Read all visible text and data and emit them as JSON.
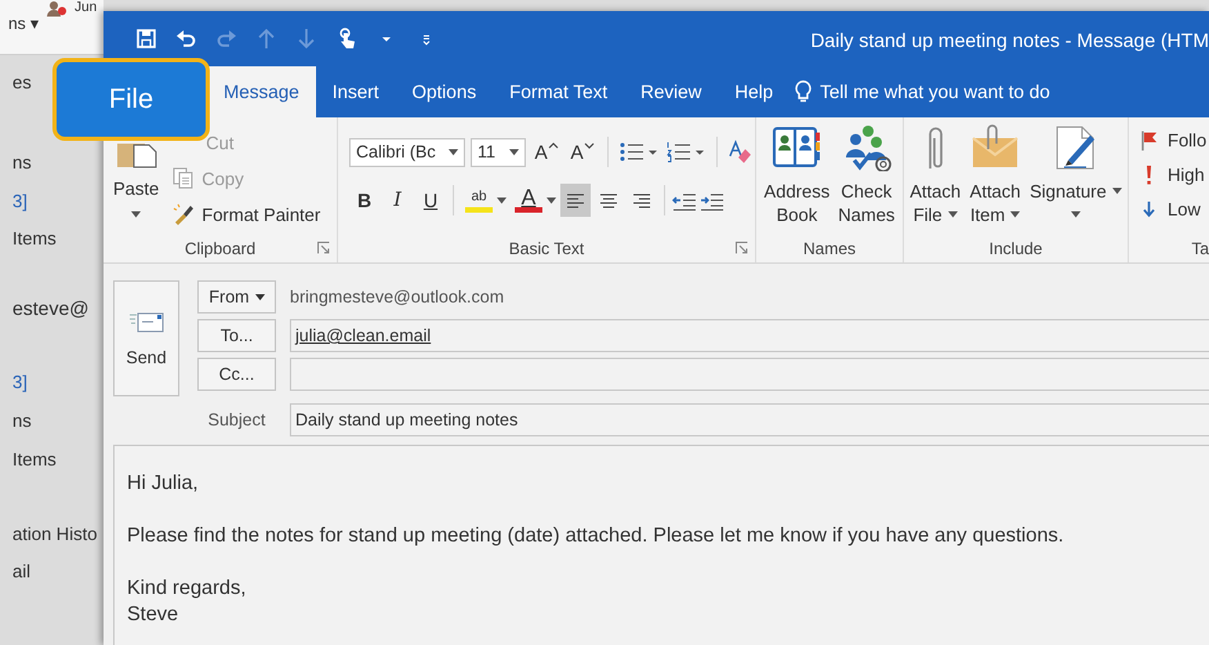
{
  "main_window": {
    "toolbar_texts": [
      "ns ▾",
      "Jun"
    ],
    "folder_items": [
      {
        "label": "es",
        "kind": "folder"
      },
      {
        "label": "ns",
        "kind": "folder"
      },
      {
        "label": "3]",
        "kind": "count"
      },
      {
        "label": "Items",
        "kind": "folder"
      },
      {
        "label": "esteve@",
        "kind": "account"
      },
      {
        "label": "3]",
        "kind": "count"
      },
      {
        "label": "ns",
        "kind": "folder"
      },
      {
        "label": "Items",
        "kind": "folder"
      },
      {
        "label": "ation Histo",
        "kind": "folder"
      },
      {
        "label": "ail",
        "kind": "folder"
      }
    ]
  },
  "message_window": {
    "title": "Daily stand up meeting notes  -  Message (HTM",
    "quick_access": [
      {
        "kind": "save",
        "disabled": false
      },
      {
        "kind": "undo",
        "disabled": false
      },
      {
        "kind": "redo",
        "disabled": true
      },
      {
        "kind": "up",
        "disabled": true
      },
      {
        "kind": "down",
        "disabled": true
      },
      {
        "kind": "touch",
        "disabled": false
      },
      {
        "kind": "dropdown",
        "disabled": false
      },
      {
        "kind": "customize",
        "disabled": false
      }
    ],
    "file_button": {
      "label": "File"
    },
    "tabs": [
      {
        "label": "Message",
        "selected": true
      },
      {
        "label": "Insert",
        "selected": false
      },
      {
        "label": "Options",
        "selected": false
      },
      {
        "label": "Format Text",
        "selected": false
      },
      {
        "label": "Review",
        "selected": false
      },
      {
        "label": "Help",
        "selected": false
      }
    ],
    "tell_me": {
      "label": "Tell me what you want to do"
    },
    "ribbon": {
      "clipboard": {
        "label": "Clipboard",
        "paste": {
          "label": "Paste"
        },
        "commands": [
          {
            "kind": "cut",
            "label": "Cut",
            "disabled": true
          },
          {
            "kind": "copy",
            "label": "Copy",
            "disabled": true
          },
          {
            "kind": "painter",
            "label": "Format Painter",
            "disabled": false
          }
        ]
      },
      "basic_text": {
        "label": "Basic Text",
        "font": "Calibri (Bc",
        "size": "11",
        "grow": "A",
        "shrink": "A",
        "bold": "B",
        "italic": "I",
        "underline": "U",
        "highlight": "ab",
        "font_color": "A",
        "alignments": [
          {
            "kind": "left",
            "selected": true
          },
          {
            "kind": "center",
            "selected": false
          },
          {
            "kind": "right",
            "selected": false
          }
        ]
      },
      "names": {
        "label": "Names",
        "buttons": [
          {
            "kind": "address-book",
            "lines": [
              "Address",
              "Book"
            ],
            "menu": false
          },
          {
            "kind": "check-names",
            "lines": [
              "Check",
              "Names"
            ],
            "menu": false
          }
        ]
      },
      "include": {
        "label": "Include",
        "buttons": [
          {
            "kind": "attach-file",
            "lines": [
              "Attach",
              "File"
            ],
            "menu": true
          },
          {
            "kind": "attach-item",
            "lines": [
              "Attach",
              "Item"
            ],
            "menu": true
          },
          {
            "kind": "signature",
            "lines": [
              "Signature"
            ],
            "menu": true
          }
        ]
      },
      "tags": {
        "label": "Ta",
        "items": [
          {
            "kind": "follow-up",
            "label": "Follo"
          },
          {
            "kind": "high",
            "label": "High"
          },
          {
            "kind": "low",
            "label": "Low"
          }
        ]
      }
    },
    "compose": {
      "send": "Send",
      "from": {
        "label": "From",
        "value": "bringmesteve@outlook.com"
      },
      "to": {
        "label": "To...",
        "value": "julia@clean.email"
      },
      "cc": {
        "label": "Cc..."
      },
      "subject": {
        "label": "Subject",
        "value": "Daily stand up meeting notes"
      },
      "body": [
        [
          "Hi Julia,"
        ],
        [
          "Please find the notes for stand up meeting (date) attached. Please let me know if you have any questions."
        ],
        [
          "Kind regards,",
          "Steve"
        ]
      ]
    }
  }
}
